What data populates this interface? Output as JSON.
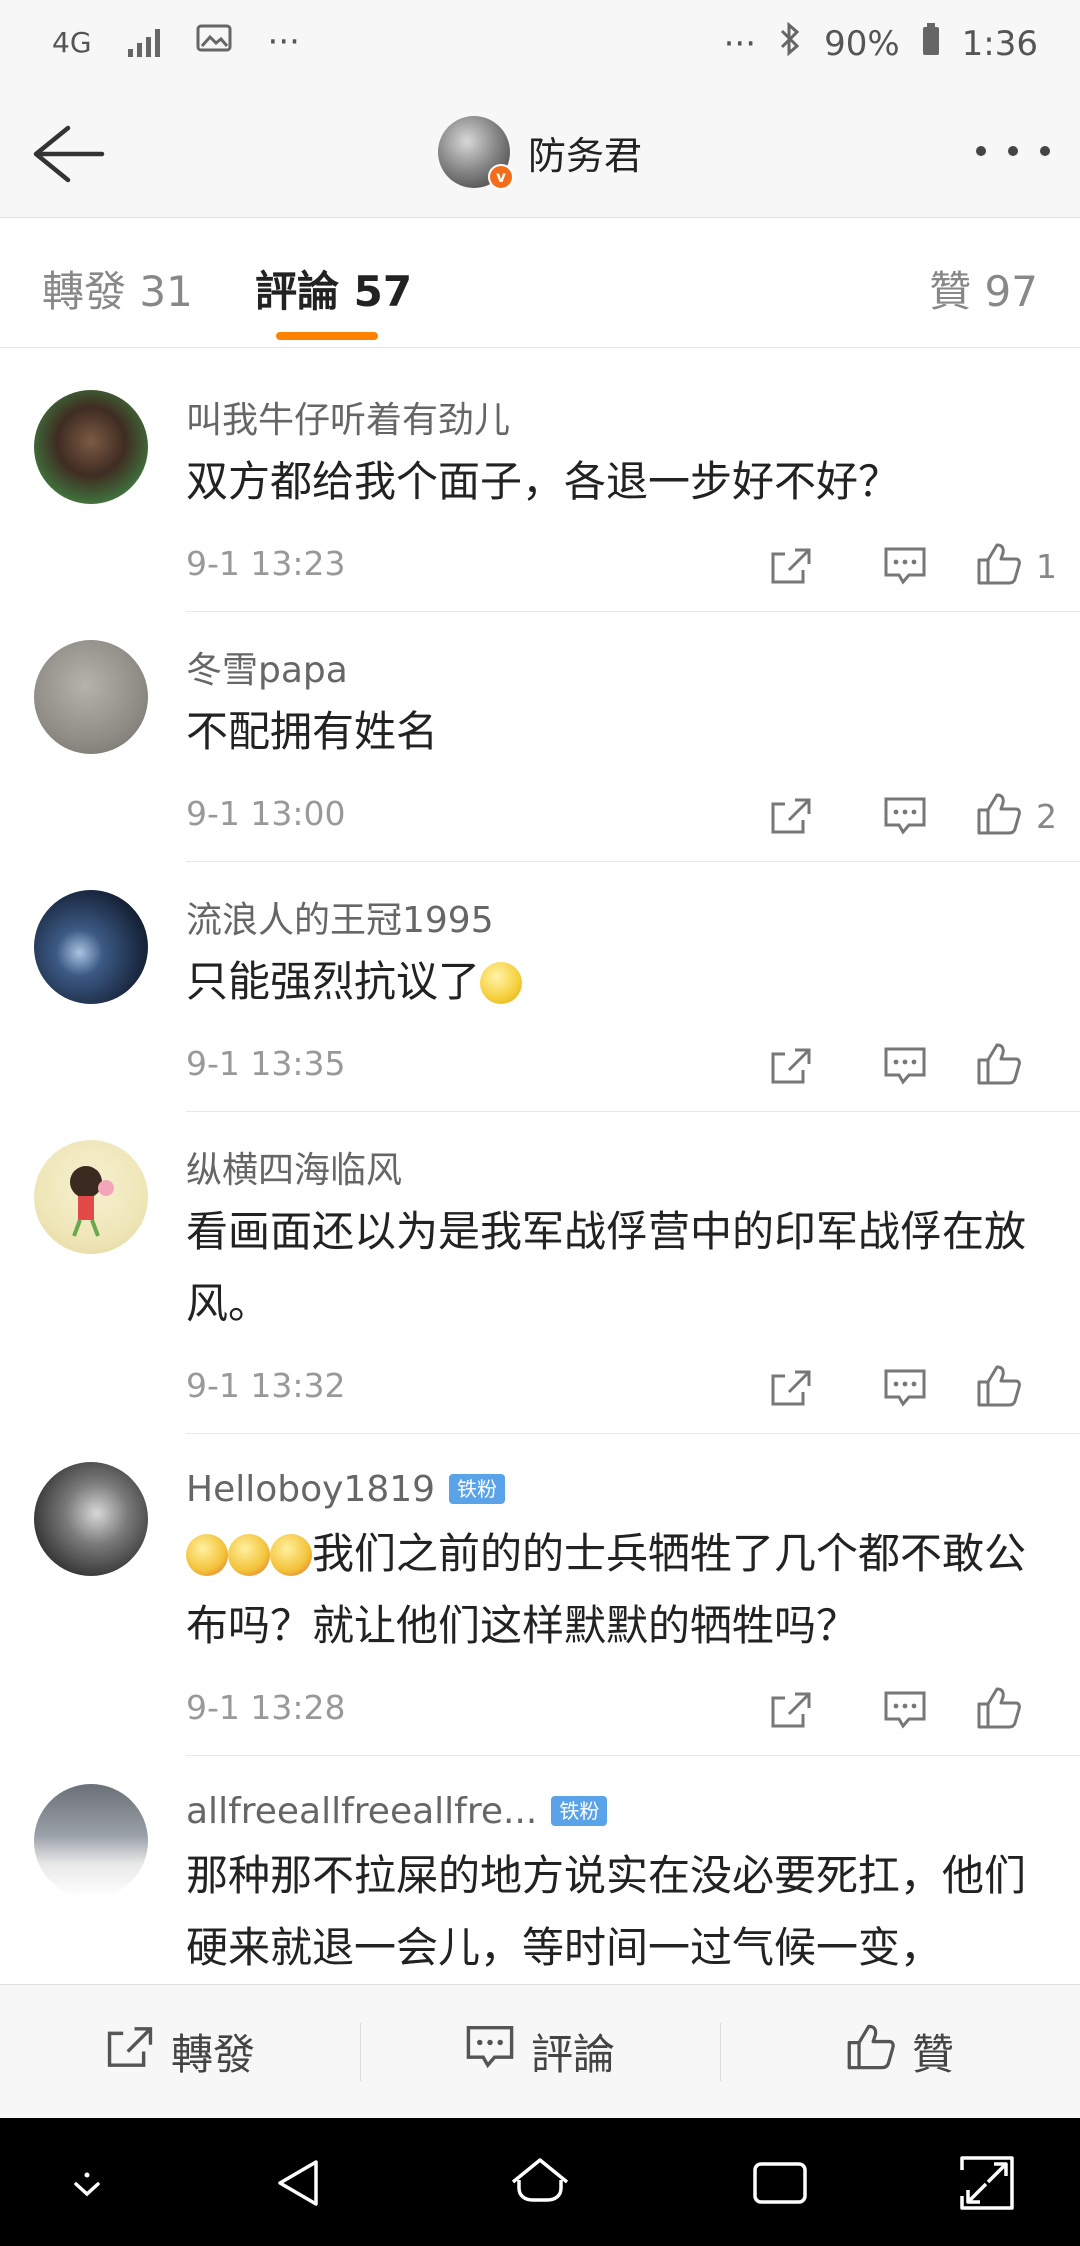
{
  "status_bar": {
    "network": "4G",
    "dots": "···",
    "right_dots": "···",
    "battery": "90%",
    "time": "1:36"
  },
  "header": {
    "title": "防务君",
    "verified_mark": "v"
  },
  "tabs": {
    "repost": "轉發 31",
    "comments": "評論 57",
    "likes": "贊 97"
  },
  "comments": [
    {
      "user": "叫我牛仔听着有劲儿",
      "badge": "",
      "text": "双方都给我个面子，各退一步好不好？",
      "time": "9-1 13:23",
      "likes": "1"
    },
    {
      "user": "冬雪papa",
      "badge": "",
      "text": "不配拥有姓名",
      "time": "9-1 13:00",
      "likes": "2"
    },
    {
      "user": "流浪人的王冠1995",
      "badge": "",
      "text": "只能强烈抗议了",
      "time": "9-1 13:35",
      "likes": ""
    },
    {
      "user": "纵横四海临风",
      "badge": "",
      "text": "看画面还以为是我军战俘营中的印军战俘在放风。",
      "time": "9-1 13:32",
      "likes": ""
    },
    {
      "user": "Helloboy1819",
      "badge": "铁粉",
      "text": "我们之前的的士兵牺牲了几个都不敢公布吗？就让他们这样默默的牺牲吗？",
      "time": "9-1 13:28",
      "likes": ""
    },
    {
      "user": "allfreeallfreeallfre...",
      "badge": "铁粉",
      "text": "那种那不拉屎的地方说实在没必要死扛，他们硬来就退一会儿，等时间一过气候一变，",
      "time": "",
      "likes": ""
    }
  ],
  "bottom_bar": {
    "repost": "轉發",
    "comment": "評論",
    "like": "贊"
  },
  "colors": {
    "accent": "#ff8200",
    "badge": "#5aa3e8"
  }
}
